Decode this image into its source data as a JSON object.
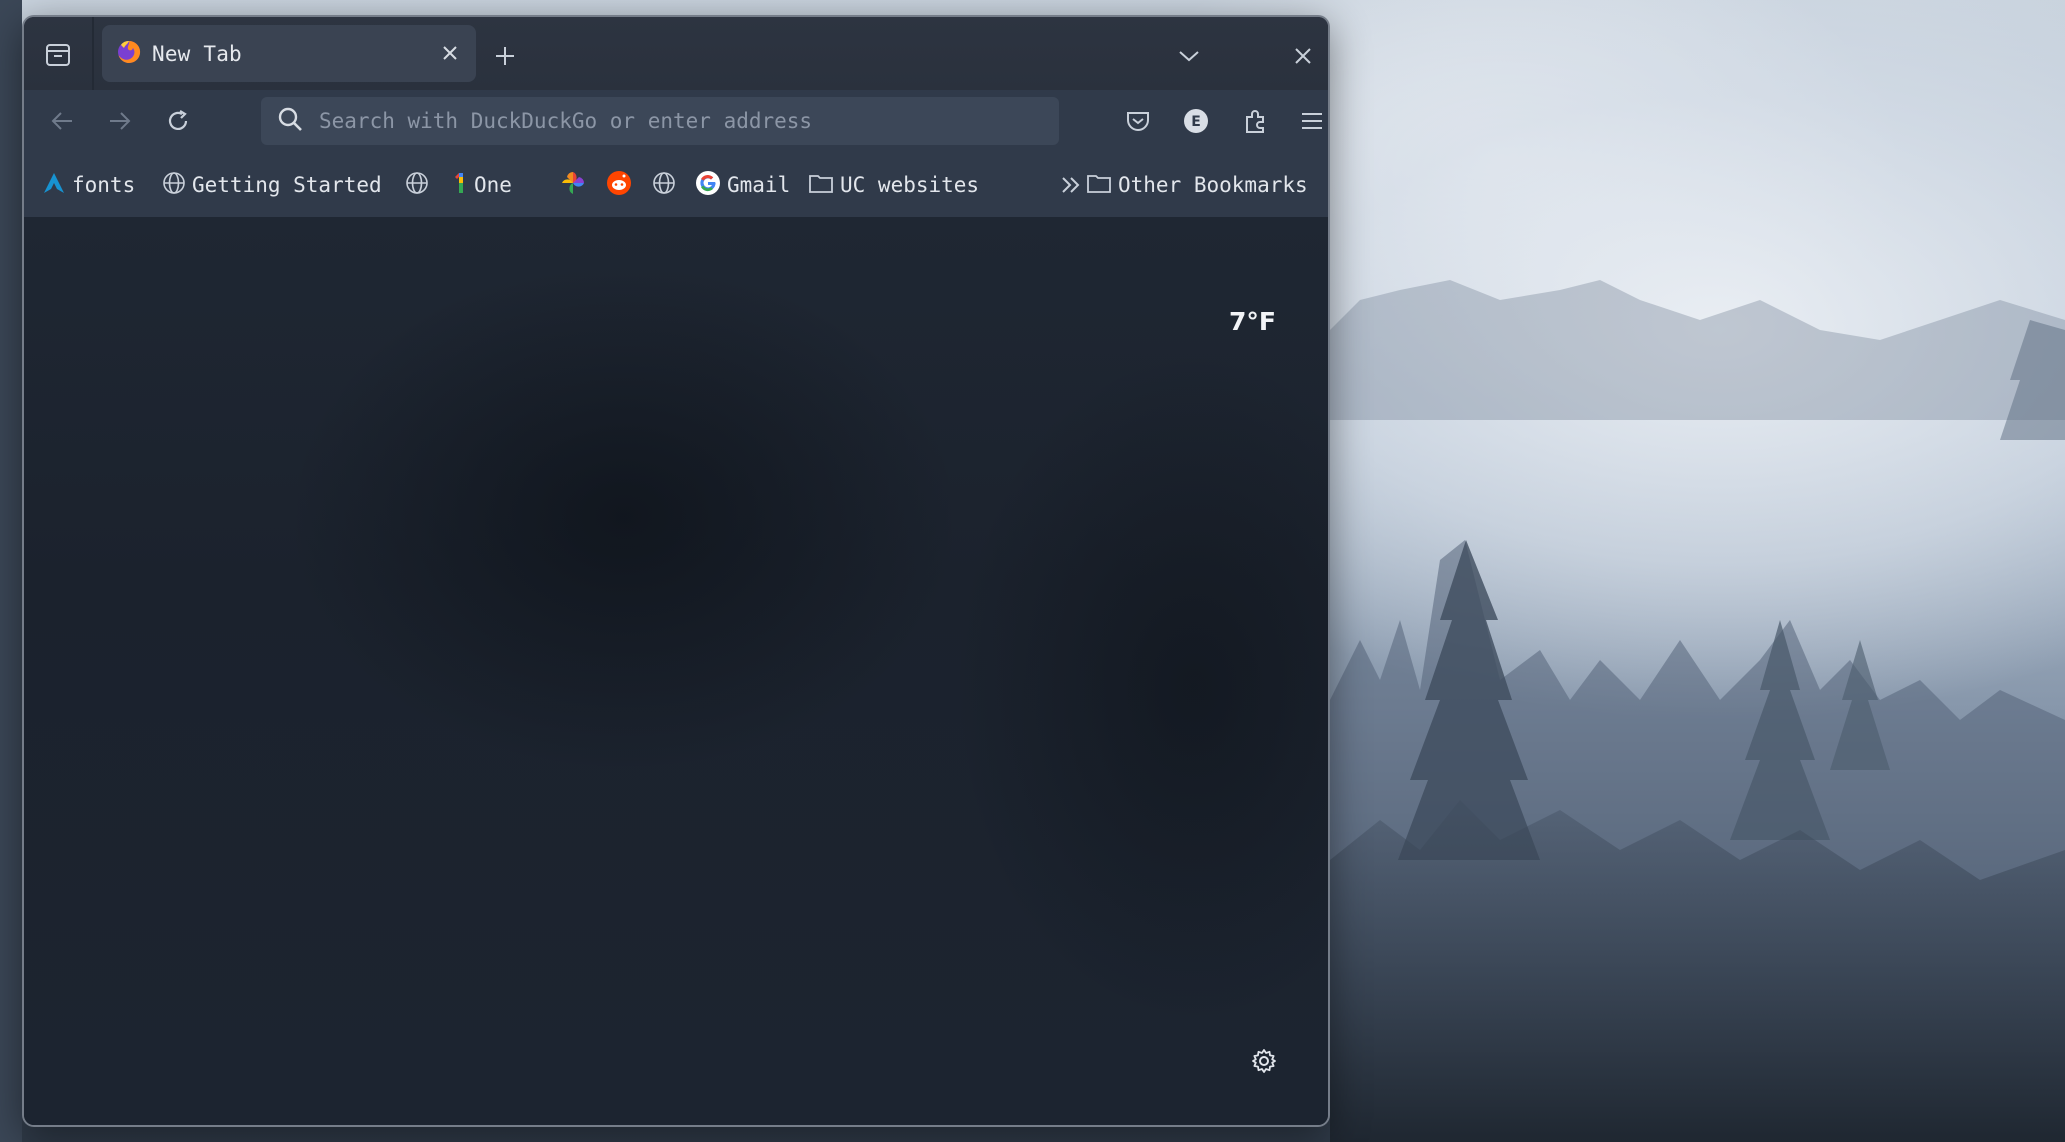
{
  "browser": {
    "tab": {
      "title": "New Tab"
    },
    "urlbar": {
      "placeholder": "Search with DuckDuckGo or enter address"
    },
    "extension_badge": "E",
    "bookmarks": [
      {
        "label": "fonts",
        "icon": "arch-logo-icon"
      },
      {
        "label": "Getting Started",
        "icon": "globe-icon"
      },
      {
        "label": "",
        "icon": "globe-icon"
      },
      {
        "label": "One",
        "icon": "google-one-icon"
      },
      {
        "label": "",
        "icon": "google-photos-icon"
      },
      {
        "label": "",
        "icon": "reddit-icon"
      },
      {
        "label": "",
        "icon": "globe-icon"
      },
      {
        "label": "Gmail",
        "icon": "google-icon"
      },
      {
        "label": "UC websites",
        "icon": "folder-icon"
      }
    ],
    "other_bookmarks": {
      "label": "Other Bookmarks",
      "icon": "folder-icon"
    }
  },
  "newtab": {
    "weather": "7°F"
  },
  "colors": {
    "window_bg": "#1d2531",
    "toolbar_bg": "#303a4a",
    "urlbar_bg": "#3c4758",
    "tab_bg": "#3a4352",
    "text": "#e2e6ec"
  }
}
